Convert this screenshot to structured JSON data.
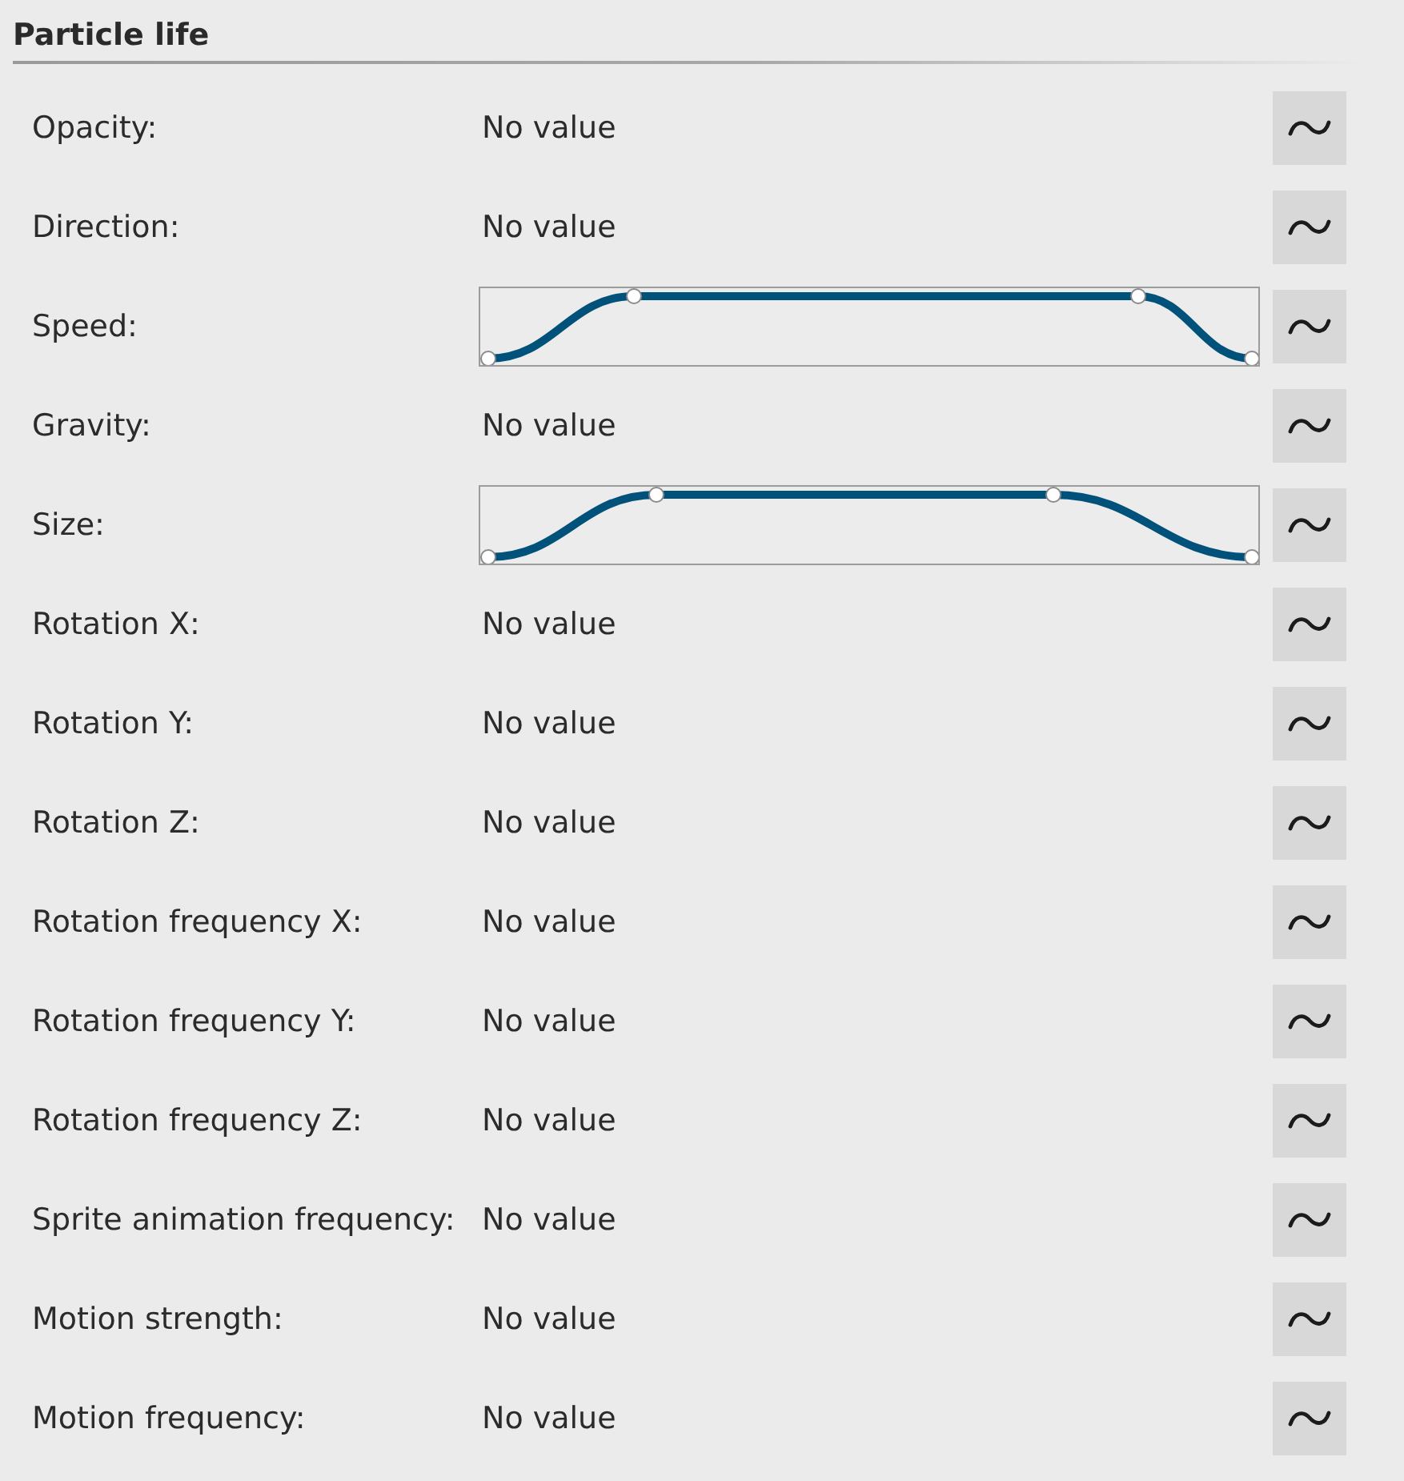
{
  "section": {
    "title": "Particle life"
  },
  "properties": [
    {
      "label": "Opacity:",
      "kind": "text",
      "value": "No value"
    },
    {
      "label": "Direction:",
      "kind": "text",
      "value": "No value"
    },
    {
      "label": "Speed:",
      "kind": "curve"
    },
    {
      "label": "Gravity:",
      "kind": "text",
      "value": "No value"
    },
    {
      "label": "Size:",
      "kind": "curve"
    },
    {
      "label": "Rotation X:",
      "kind": "text",
      "value": "No value"
    },
    {
      "label": "Rotation Y:",
      "kind": "text",
      "value": "No value"
    },
    {
      "label": "Rotation Z:",
      "kind": "text",
      "value": "No value"
    },
    {
      "label": "Rotation frequency X:",
      "kind": "text",
      "value": "No value"
    },
    {
      "label": "Rotation frequency Y:",
      "kind": "text",
      "value": "No value"
    },
    {
      "label": "Rotation frequency Z:",
      "kind": "text",
      "value": "No value"
    },
    {
      "label": "Sprite animation frequency:",
      "kind": "text",
      "value": "No value"
    },
    {
      "label": "Motion strength:",
      "kind": "text",
      "value": "No value"
    },
    {
      "label": "Motion frequency:",
      "kind": "text",
      "value": "No value"
    }
  ]
}
